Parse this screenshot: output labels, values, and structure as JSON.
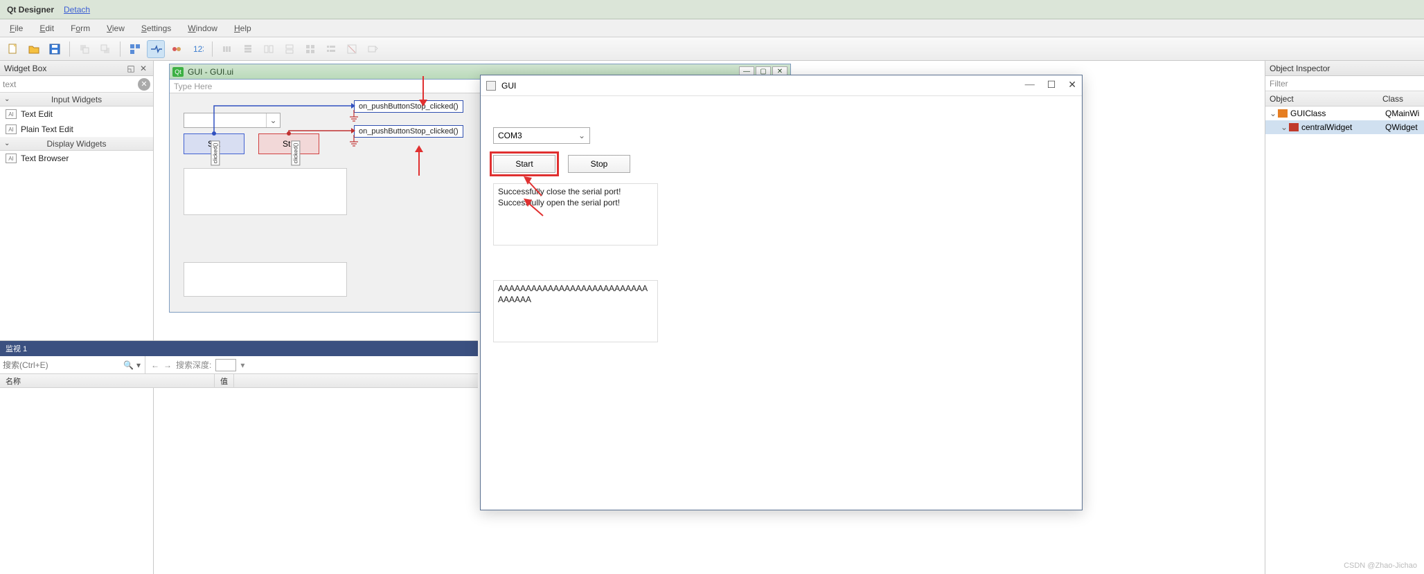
{
  "header": {
    "title": "Qt Designer",
    "detach": "Detach"
  },
  "menu": {
    "file": "File",
    "edit": "Edit",
    "form": "Form",
    "view": "View",
    "settings": "Settings",
    "window": "Window",
    "help": "Help"
  },
  "widgetbox": {
    "title": "Widget Box",
    "filter_placeholder": "text",
    "cat_input": "Input Widgets",
    "cat_display": "Display Widgets",
    "items_input": [
      "Text Edit",
      "Plain Text Edit"
    ],
    "items_display": [
      "Text Browser"
    ]
  },
  "subwin": {
    "title": "GUI - GUI.ui",
    "type_here": "Type Here",
    "btn_start": "St   t",
    "btn_stop": "St   t",
    "sig_clicked": "clicked()",
    "slot1": "on_pushButtonStop_clicked()",
    "slot2": "on_pushButtonStop_clicked()"
  },
  "inspector": {
    "title": "Object Inspector",
    "filter": "Filter",
    "col_object": "Object",
    "col_class": "Class",
    "rows": [
      {
        "name": "GUIClass",
        "cls": "QMainWindow",
        "indent": 0
      },
      {
        "name": "centralWidget",
        "cls": "QWidget",
        "indent": 1
      }
    ]
  },
  "monitor": {
    "title": "监视 1",
    "search_placeholder": "搜索(Ctrl+E)",
    "depth_label": "搜索深度:",
    "col_name": "名称",
    "col_value": "值"
  },
  "runtime": {
    "title": "GUI",
    "combo_value": "COM3",
    "btn_start": "Start",
    "btn_stop": "Stop",
    "log": "Successfully close the serial port!\nSuccessfully open the serial port!",
    "output": "AAAAAAAAAAAAAAAAAAAAAAAAAAAAAAAAA"
  },
  "watermark": "CSDN @Zhao-Jichao"
}
